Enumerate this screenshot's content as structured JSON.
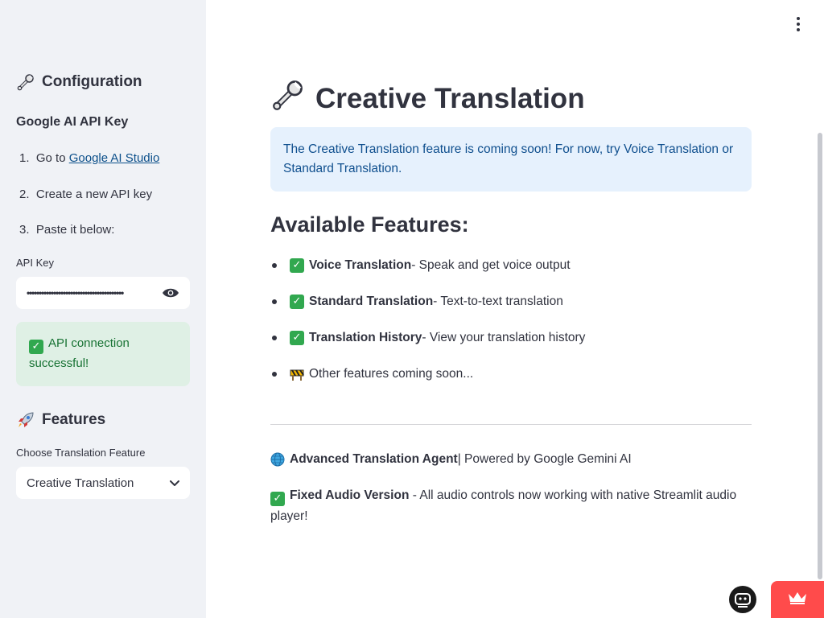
{
  "sidebar": {
    "config_heading": "Configuration",
    "api_key_heading": "Google AI API Key",
    "steps": [
      {
        "num": "1.",
        "text": "Go to ",
        "link": "Google AI Studio"
      },
      {
        "num": "2.",
        "text": "Create a new API key"
      },
      {
        "num": "3.",
        "text": "Paste it below:"
      }
    ],
    "api_key_label": "API Key",
    "api_key_value": "••••••••••••••••••••••••••••••••••••••••",
    "success_message": "API connection successful!",
    "features_heading": "Features",
    "feature_select_label": "Choose Translation Feature",
    "feature_select_value": "Creative Translation"
  },
  "main": {
    "title": "Creative Translation",
    "info_message": "The Creative Translation feature is coming soon! For now, try Voice Translation or Standard Translation.",
    "features_heading": "Available Features:",
    "features": [
      {
        "name": "Voice Translation",
        "desc": " - Speak and get voice output",
        "icon": "check-icon"
      },
      {
        "name": "Standard Translation",
        "desc": " - Text-to-text translation",
        "icon": "check-icon"
      },
      {
        "name": "Translation History",
        "desc": " - View your translation history",
        "icon": "check-icon"
      },
      {
        "name": "",
        "desc": "Other features coming soon...",
        "icon": "construction-icon"
      }
    ],
    "footer": {
      "agent_name": "Advanced Translation Agent",
      "agent_suffix": " | Powered by Google Gemini AI",
      "fixed_title": "Fixed Audio Version",
      "fixed_desc": " - All audio controls now working with native Streamlit audio player!"
    }
  },
  "colors": {
    "sidebar_bg": "#f0f2f6",
    "info_bg": "#e6f1fd",
    "info_text": "#0f4f8e",
    "success_bg": "#dff0e5",
    "success_text": "#177233",
    "accent_red": "#ff4b4b"
  }
}
